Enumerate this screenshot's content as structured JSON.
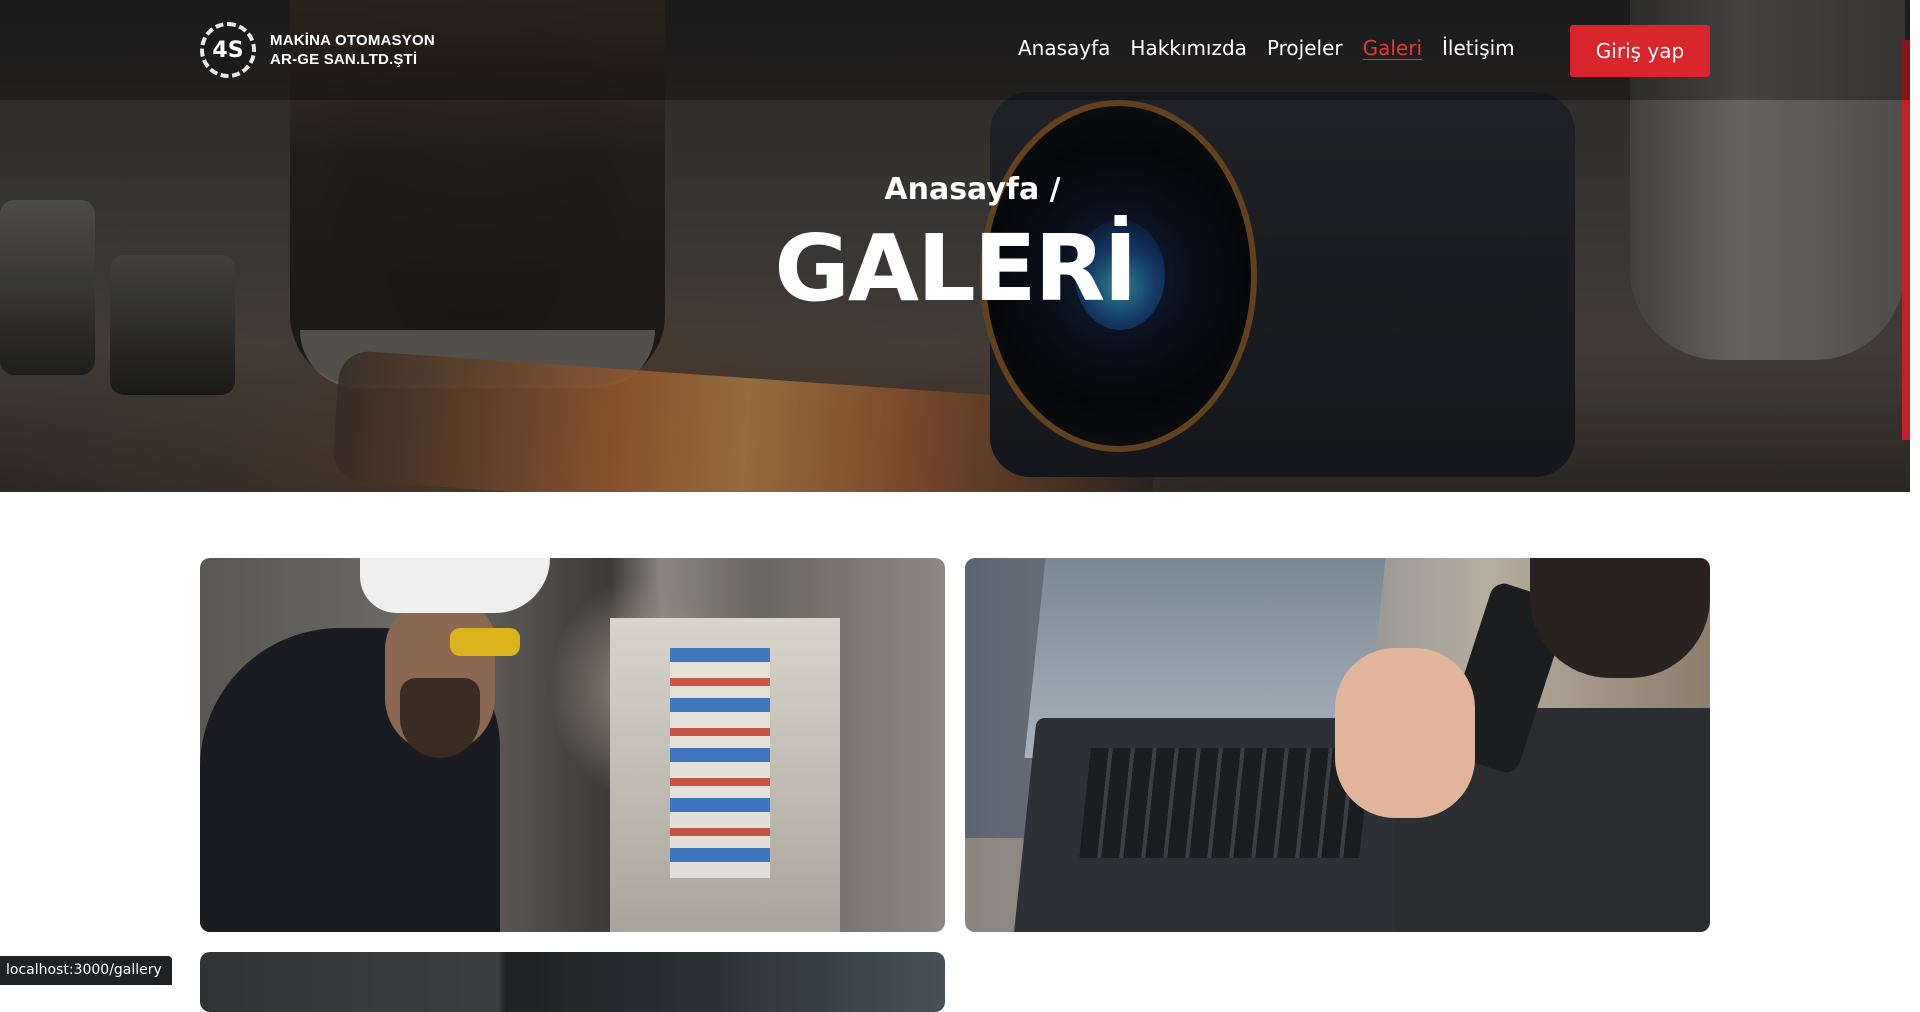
{
  "brand": {
    "logo_text": "4S",
    "line1": "MAKİNA OTOMASYON",
    "line2": "AR-GE SAN.LTD.ŞTİ"
  },
  "nav": {
    "items": [
      {
        "label": "Anasayfa",
        "active": false
      },
      {
        "label": "Hakkımızda",
        "active": false
      },
      {
        "label": "Projeler",
        "active": false
      },
      {
        "label": "Galeri",
        "active": true
      },
      {
        "label": "İletişim",
        "active": false
      }
    ],
    "login_label": "Giriş yap"
  },
  "hero": {
    "breadcrumb": "Anasayfa /",
    "title": "GALERİ"
  },
  "status": {
    "url": "localhost:3000/gallery"
  },
  "colors": {
    "accent": "#d8262c",
    "active_link": "#e53935"
  }
}
